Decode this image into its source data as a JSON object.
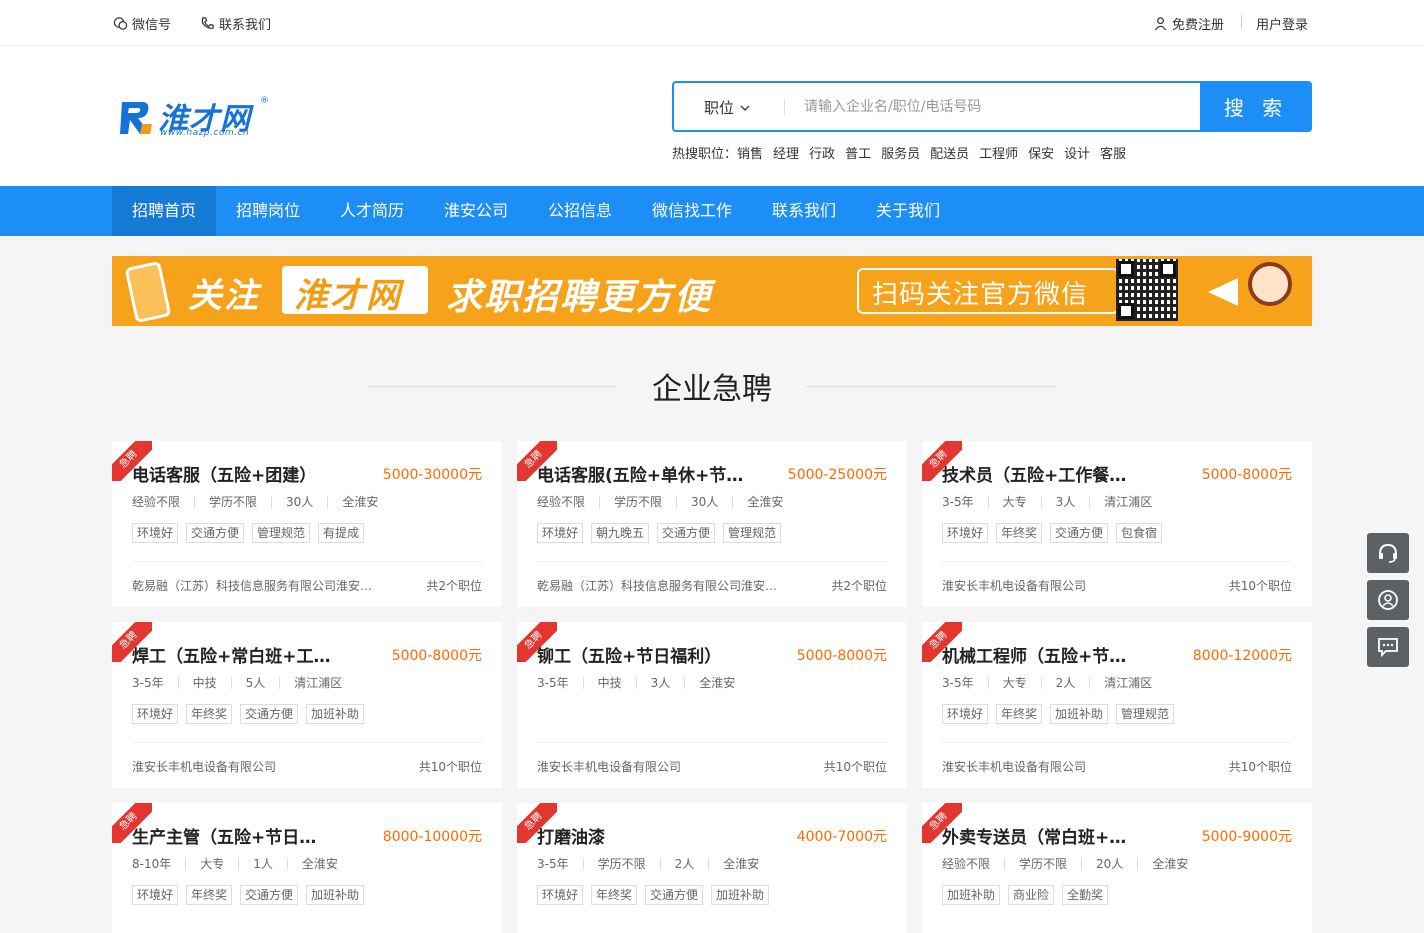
{
  "topbar": {
    "wechat": "微信号",
    "contact": "联系我们",
    "register": "免费注册",
    "login": "用户登录"
  },
  "logo": {
    "name": "淮才网",
    "url": "www.hazp.com.cn",
    "reg": "®"
  },
  "search": {
    "category": "职位",
    "placeholder": "请输入企业名/职位/电话号码",
    "button": "搜 索"
  },
  "hot": {
    "label": "热搜职位：",
    "items": [
      "销售",
      "经理",
      "行政",
      "普工",
      "服务员",
      "配送员",
      "工程师",
      "保安",
      "设计",
      "客服"
    ]
  },
  "nav": [
    "招聘首页",
    "招聘岗位",
    "人才简历",
    "淮安公司",
    "公招信息",
    "微信找工作",
    "联系我们",
    "关于我们"
  ],
  "banner": {
    "t1": "关注",
    "t2": "淮才网",
    "t3": "求职招聘更方便",
    "t4": "扫码关注官方微信"
  },
  "section": {
    "title": "企业急聘"
  },
  "urgent_label": "急聘",
  "jobs": [
    {
      "title": "电话客服（五险+团建）",
      "salary": "5000-30000元",
      "meta": [
        "经验不限",
        "学历不限",
        "30人",
        "全淮安"
      ],
      "tags": [
        "环境好",
        "交通方便",
        "管理规范",
        "有提成"
      ],
      "company": "乾易融（江苏）科技信息服务有限公司淮安…",
      "count": "共2个职位"
    },
    {
      "title": "电话客服(五险+单休+节…",
      "salary": "5000-25000元",
      "meta": [
        "经验不限",
        "学历不限",
        "30人",
        "全淮安"
      ],
      "tags": [
        "环境好",
        "朝九晚五",
        "交通方便",
        "管理规范"
      ],
      "company": "乾易融（江苏）科技信息服务有限公司淮安…",
      "count": "共2个职位"
    },
    {
      "title": "技术员（五险+工作餐…",
      "salary": "5000-8000元",
      "meta": [
        "3-5年",
        "大专",
        "3人",
        "清江浦区"
      ],
      "tags": [
        "环境好",
        "年终奖",
        "交通方便",
        "包食宿"
      ],
      "company": "淮安长丰机电设备有限公司",
      "count": "共10个职位"
    },
    {
      "title": "焊工（五险+常白班+工…",
      "salary": "5000-8000元",
      "meta": [
        "3-5年",
        "中技",
        "5人",
        "清江浦区"
      ],
      "tags": [
        "环境好",
        "年终奖",
        "交通方便",
        "加班补助"
      ],
      "company": "淮安长丰机电设备有限公司",
      "count": "共10个职位"
    },
    {
      "title": "铆工（五险+节日福利）",
      "salary": "5000-8000元",
      "meta": [
        "3-5年",
        "中技",
        "3人",
        "全淮安"
      ],
      "tags": [],
      "company": "淮安长丰机电设备有限公司",
      "count": "共10个职位"
    },
    {
      "title": "机械工程师（五险+节…",
      "salary": "8000-12000元",
      "meta": [
        "3-5年",
        "大专",
        "2人",
        "清江浦区"
      ],
      "tags": [
        "环境好",
        "年终奖",
        "加班补助",
        "管理规范"
      ],
      "company": "淮安长丰机电设备有限公司",
      "count": "共10个职位"
    },
    {
      "title": "生产主管（五险+节日…",
      "salary": "8000-10000元",
      "meta": [
        "8-10年",
        "大专",
        "1人",
        "全淮安"
      ],
      "tags": [
        "环境好",
        "年终奖",
        "交通方便",
        "加班补助"
      ],
      "company": "",
      "count": ""
    },
    {
      "title": "打磨油漆",
      "salary": "4000-7000元",
      "meta": [
        "3-5年",
        "学历不限",
        "2人",
        "全淮安"
      ],
      "tags": [
        "环境好",
        "年终奖",
        "交通方便",
        "加班补助"
      ],
      "company": "",
      "count": ""
    },
    {
      "title": "外卖专送员（常白班+…",
      "salary": "5000-9000元",
      "meta": [
        "经验不限",
        "学历不限",
        "20人",
        "全淮安"
      ],
      "tags": [
        "加班补助",
        "商业险",
        "全勤奖"
      ],
      "company": "",
      "count": ""
    }
  ],
  "colors": {
    "primary": "#1d8ef5",
    "salary": "#ff6a00",
    "urgent": "#e2362f",
    "banner": "#f7a21b"
  }
}
